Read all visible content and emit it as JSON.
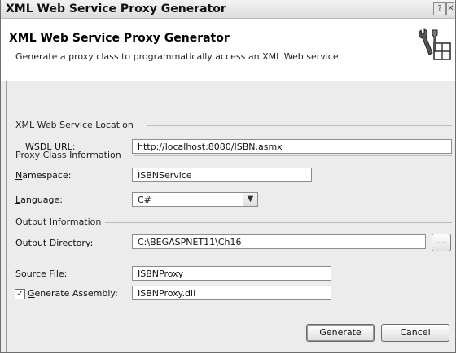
{
  "window": {
    "title": "XML Web Service Proxy Generator",
    "help_glyph": "?",
    "close_glyph": "✕"
  },
  "header": {
    "title": "XML Web Service Proxy Generator",
    "description": "Generate a proxy class to programmatically access an XML Web service.",
    "icon": "proxy-tools-icon"
  },
  "location": {
    "section_title": "XML Web Service Location",
    "wsdl_label_pre": "WSDL ",
    "wsdl_label_ul": "U",
    "wsdl_label_post": "RL:",
    "wsdl_value": "http://localhost:8080/ISBN.asmx"
  },
  "proxy": {
    "section_title": "Proxy Class Information",
    "namespace_label_ul": "N",
    "namespace_label_post": "amespace:",
    "namespace_value": "ISBNService",
    "language_label_ul": "L",
    "language_label_post": "anguage:",
    "language_value": "C#",
    "dropdown_glyph": "▼"
  },
  "output": {
    "section_title": "Output Information",
    "directory_label_ul": "O",
    "directory_label_post": "utput Directory:",
    "directory_value": "C:\\BEGASPNET11\\Ch16",
    "browse_label": "...",
    "source_label_ul": "S",
    "source_label_post": "ource File:",
    "source_value": "ISBNProxy",
    "generate_assembly_checked": true,
    "check_glyph": "✓",
    "assembly_label_ul": "G",
    "assembly_label_post": "enerate Assembly:",
    "assembly_value": "ISBNProxy.dll"
  },
  "buttons": {
    "generate": "Generate",
    "cancel": "Cancel"
  }
}
